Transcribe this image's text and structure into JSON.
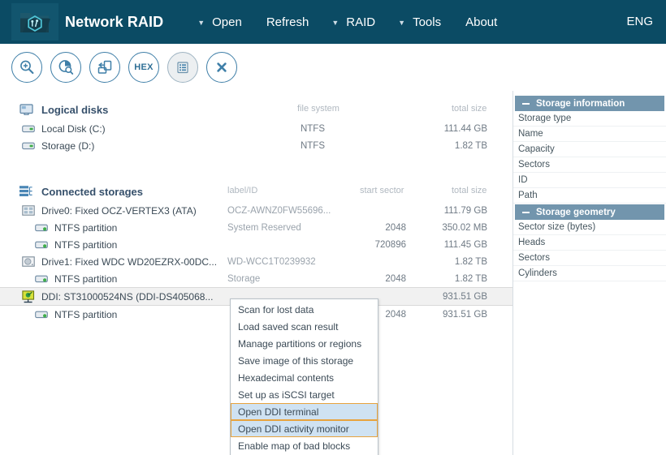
{
  "header": {
    "logo_icon": "folder-network-hex-icon",
    "app_title": "Network RAID",
    "language": "ENG",
    "menus": [
      {
        "caret": "▼",
        "label": "Open",
        "has_caret": true
      },
      {
        "caret": "",
        "label": "Refresh",
        "has_caret": false
      },
      {
        "caret": "▼",
        "label": "RAID",
        "has_caret": true
      },
      {
        "caret": "▼",
        "label": "Tools",
        "has_caret": true
      },
      {
        "caret": "",
        "label": "About",
        "has_caret": false
      }
    ]
  },
  "toolbar": {
    "buttons": [
      {
        "name": "find-icon",
        "glyph": "magnifier-plus",
        "active": false
      },
      {
        "name": "disk-scan-icon",
        "glyph": "pie-magnifier",
        "active": false
      },
      {
        "name": "save-image-icon",
        "glyph": "copy-arrow",
        "active": false
      },
      {
        "name": "hex-editor-icon",
        "glyph": "hex-text",
        "label": "HEX",
        "active": false
      },
      {
        "name": "list-view-icon",
        "glyph": "list-lines",
        "active": true
      },
      {
        "name": "close-icon",
        "glyph": "x-mark",
        "active": false
      }
    ]
  },
  "logical_disks": {
    "icon": "monitor-icon",
    "title": "Logical disks",
    "columns": {
      "file_system": "file system",
      "total_size": "total size"
    },
    "rows": [
      {
        "icon": "drive-icon",
        "name": "Local Disk (C:)",
        "file_system": "NTFS",
        "total_size": "111.44 GB"
      },
      {
        "icon": "drive-icon",
        "name": "Storage (D:)",
        "file_system": "NTFS",
        "total_size": "1.82 TB"
      }
    ]
  },
  "connected_storages": {
    "icon": "storage-stack-icon",
    "title": "Connected storages",
    "columns": {
      "label_id": "label/ID",
      "start_sector": "start sector",
      "total_size": "total size"
    },
    "rows": [
      {
        "icon": "raid-grid-icon",
        "name": "Drive0: Fixed OCZ-VERTEX3 (ATA)",
        "label_id": "OCZ-AWNZ0FW55696...",
        "start_sector": "",
        "total_size": "111.79 GB",
        "indent": 1,
        "selected": false
      },
      {
        "icon": "partition-icon",
        "name": "NTFS partition",
        "label_id": "System Reserved",
        "start_sector": "2048",
        "total_size": "350.02 MB",
        "indent": 2,
        "selected": false
      },
      {
        "icon": "partition-icon",
        "name": "NTFS partition",
        "label_id": "",
        "start_sector": "720896",
        "total_size": "111.45 GB",
        "indent": 2,
        "selected": false
      },
      {
        "icon": "platter-icon",
        "name": "Drive1: Fixed WDC WD20EZRX-00DC...",
        "label_id": "WD-WCC1T0239932",
        "start_sector": "",
        "total_size": "1.82 TB",
        "indent": 1,
        "selected": false
      },
      {
        "icon": "partition-icon",
        "name": "NTFS partition",
        "label_id": "Storage",
        "start_sector": "2048",
        "total_size": "1.82 TB",
        "indent": 2,
        "selected": false
      },
      {
        "icon": "ddi-network-icon",
        "name": "DDI: ST31000524NS (DDI-DS405068...",
        "label_id": "",
        "start_sector": "",
        "total_size": "931.51 GB",
        "indent": 1,
        "selected": true
      },
      {
        "icon": "partition-icon",
        "name": "NTFS partition",
        "label_id": "",
        "start_sector": "2048",
        "total_size": "931.51 GB",
        "indent": 2,
        "selected": false
      }
    ]
  },
  "sidebar": {
    "sections": [
      {
        "title": "Storage information",
        "collapse_icon": "minus-icon",
        "rows": [
          "Storage type",
          "Name",
          "Capacity",
          "Sectors",
          "ID",
          "Path"
        ]
      },
      {
        "title": "Storage geometry",
        "collapse_icon": "minus-icon",
        "rows": [
          "Sector size (bytes)",
          "Heads",
          "Sectors",
          "Cylinders"
        ]
      }
    ]
  },
  "context_menu": {
    "items": [
      {
        "label": "Scan for lost data",
        "highlighted": false
      },
      {
        "label": "Load saved scan result",
        "highlighted": false
      },
      {
        "label": "Manage partitions or regions",
        "highlighted": false
      },
      {
        "label": "Save image of this storage",
        "highlighted": false
      },
      {
        "label": "Hexadecimal contents",
        "highlighted": false
      },
      {
        "label": "Set up as iSCSI target",
        "highlighted": false
      },
      {
        "label": "Open DDI terminal",
        "highlighted": true
      },
      {
        "label": "Open DDI activity monitor",
        "highlighted": true
      },
      {
        "label": "Enable map of bad blocks",
        "highlighted": false
      }
    ]
  },
  "colors": {
    "header_bg": "#0b4b64",
    "toolbar_icon": "#3f7fa8",
    "sidebar_head_bg": "#7295ad",
    "menu_highlight_border": "#e8a33d",
    "menu_highlight_bg": "#cfe2f2",
    "selected_row_bg": "#f1f1f1",
    "column_header_text": "#b0b8c0"
  }
}
